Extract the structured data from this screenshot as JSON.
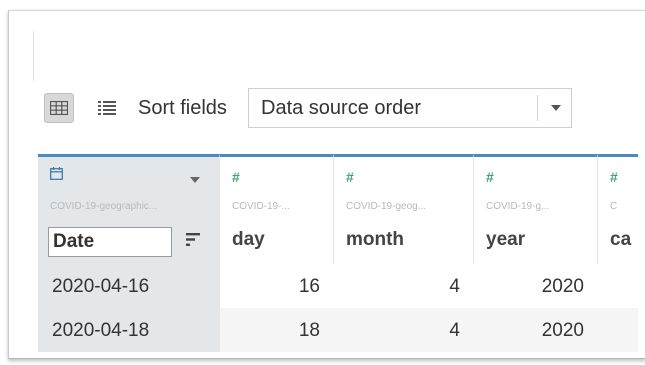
{
  "toolbar": {
    "sort_label": "Sort fields",
    "sort_value": "Data source order",
    "grid_view_icon": "grid-icon",
    "list_view_icon": "list-icon"
  },
  "columns": [
    {
      "type_icon": "calendar-icon",
      "source": "COVID-19-geographic...",
      "name": "Date",
      "selected": true
    },
    {
      "type_icon": "#",
      "source": "COVID-19-...",
      "name": "day"
    },
    {
      "type_icon": "#",
      "source": "COVID-19-geog...",
      "name": "month"
    },
    {
      "type_icon": "#",
      "source": "COVID-19-g...",
      "name": "year"
    },
    {
      "type_icon": "#",
      "source": "C",
      "name": "ca"
    }
  ],
  "rows": [
    [
      "2020-04-16",
      "16",
      "4",
      "2020"
    ],
    [
      "2020-04-18",
      "18",
      "4",
      "2020"
    ]
  ],
  "colors": {
    "accent": "#4a8cc2",
    "number_icon": "#3fa66a",
    "selected_bg": "#e4e7ea"
  }
}
